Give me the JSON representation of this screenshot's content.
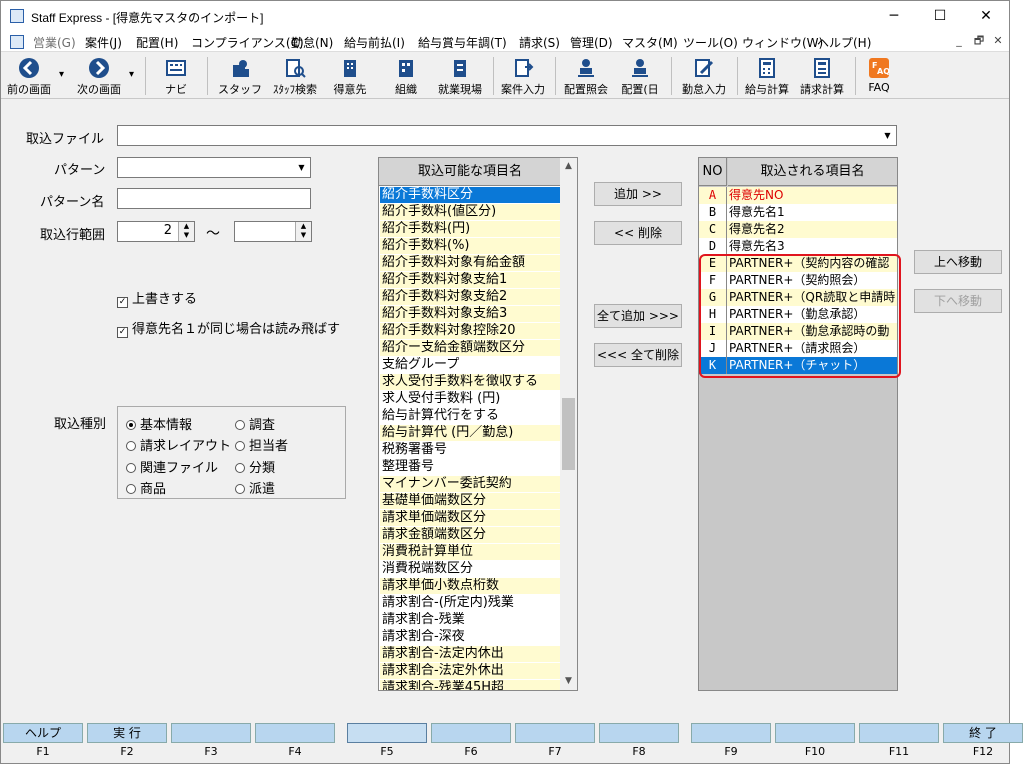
{
  "window": {
    "title": "Staff Express - [得意先マスタのインポート]",
    "controls": {
      "minimize": "─",
      "maximize": "☐",
      "close": "✕"
    }
  },
  "menu": {
    "items": [
      "営業(G)",
      "案件(J)",
      "配置(H)",
      "コンプライアンス(C)",
      "勤怠(N)",
      "給与前払(I)",
      "給与賞与年調(T)",
      "請求(S)",
      "管理(D)",
      "マスタ(M)",
      "ツール(O)",
      "ウィンドウ(W)",
      "ヘルプ(H)"
    ],
    "mdi": {
      "minimize": "_",
      "restore": "🗗",
      "close": "✕"
    }
  },
  "toolbar": {
    "items": [
      "前の画面",
      "次の画面",
      "ナビ",
      "スタッフ",
      "ｽﾀｯﾌ検索",
      "得意先",
      "組織",
      "就業現場",
      "案件入力",
      "配置照会",
      "配置(日",
      "勤怠入力",
      "給与計算",
      "請求計算",
      "FAQ"
    ],
    "dropdown_glyph": "▾"
  },
  "form": {
    "import_file_label": "取込ファイル",
    "import_file_value": "",
    "pattern_label": "パターン",
    "pattern_value": "",
    "pattern_name_label": "パターン名",
    "pattern_name_value": "",
    "range_label": "取込行範囲",
    "range_from": "2",
    "range_tilde": "～",
    "range_to": "",
    "overwrite_label": "上書きする",
    "overwrite_checked": true,
    "skip_same_name_label": "得意先名１が同じ場合は読み飛ばす",
    "skip_same_name_checked": true,
    "check_mark": "✓",
    "import_type_label": "取込種別",
    "import_types": [
      {
        "label": "基本情報",
        "checked": true
      },
      {
        "label": "調査",
        "checked": false
      },
      {
        "label": "請求レイアウト",
        "checked": false
      },
      {
        "label": "担当者",
        "checked": false
      },
      {
        "label": "関連ファイル",
        "checked": false
      },
      {
        "label": "分類",
        "checked": false
      },
      {
        "label": "商品",
        "checked": false
      },
      {
        "label": "派遣",
        "checked": false
      }
    ]
  },
  "available": {
    "header": "取込可能な項目名",
    "items": [
      "紹介手数料区分",
      "紹介手数料(値区分)",
      "紹介手数料(円)",
      "紹介手数料(%)",
      "紹介手数料対象有給金額",
      "紹介手数料対象支給1",
      "紹介手数料対象支給2",
      "紹介手数料対象支給3",
      "紹介手数料対象控除20",
      "紹介ー支給金額端数区分",
      "支給グループ",
      "求人受付手数料を徴収する",
      "求人受付手数料 (円)",
      "給与計算代行をする",
      "給与計算代 (円／勤怠)",
      "税務署番号",
      "整理番号",
      "マイナンバー委託契約",
      "基礎単価端数区分",
      "請求単価端数区分",
      "請求金額端数区分",
      "消費税計算単位",
      "消費税端数区分",
      "請求単価小数点桁数",
      "請求割合-(所定内)残業",
      "請求割合-残業",
      "請求割合-深夜",
      "請求割合-法定内休出",
      "請求割合-法定外休出",
      "請求割合-残業45H超"
    ],
    "selected_index": 0,
    "scroll_up": "▲",
    "scroll_down": "▼"
  },
  "buttons": {
    "add": "追加 >>",
    "remove": "<< 削除",
    "add_all": "全て追加 >>>",
    "remove_all": "<<< 全て削除",
    "move_up": "上へ移動",
    "move_down": "下へ移動"
  },
  "selected": {
    "header_no": "NO",
    "header_name": "取込される項目名",
    "rows": [
      {
        "no": "A",
        "name": "得意先NO",
        "red": true
      },
      {
        "no": "B",
        "name": "得意先名1"
      },
      {
        "no": "C",
        "name": "得意先名2"
      },
      {
        "no": "D",
        "name": "得意先名3"
      },
      {
        "no": "E",
        "name": "PARTNER+（契約内容の確認"
      },
      {
        "no": "F",
        "name": "PARTNER+（契約照会）"
      },
      {
        "no": "G",
        "name": "PARTNER+（QR読取と申請時"
      },
      {
        "no": "H",
        "name": "PARTNER+（勤怠承認）"
      },
      {
        "no": "I",
        "name": "PARTNER+（勤怠承認時の動"
      },
      {
        "no": "J",
        "name": "PARTNER+（請求照会）"
      },
      {
        "no": "K",
        "name": "PARTNER+（チャット）"
      }
    ],
    "selected_index": 10
  },
  "fkeys": [
    {
      "label": "ヘルプ",
      "key": "F1"
    },
    {
      "label": "実 行",
      "key": "F2"
    },
    {
      "label": "",
      "key": "F3"
    },
    {
      "label": "",
      "key": "F4"
    },
    {
      "label": "",
      "key": "F5"
    },
    {
      "label": "",
      "key": "F6"
    },
    {
      "label": "",
      "key": "F7"
    },
    {
      "label": "",
      "key": "F8"
    },
    {
      "label": "",
      "key": "F9"
    },
    {
      "label": "",
      "key": "F10"
    },
    {
      "label": "",
      "key": "F11"
    },
    {
      "label": "終 了",
      "key": "F12"
    }
  ],
  "colors": {
    "accent": "#0a78d7",
    "row_yellow": "#fffbd0",
    "highlight_red": "#e0141e",
    "icon_blue": "#1f4e8c"
  }
}
